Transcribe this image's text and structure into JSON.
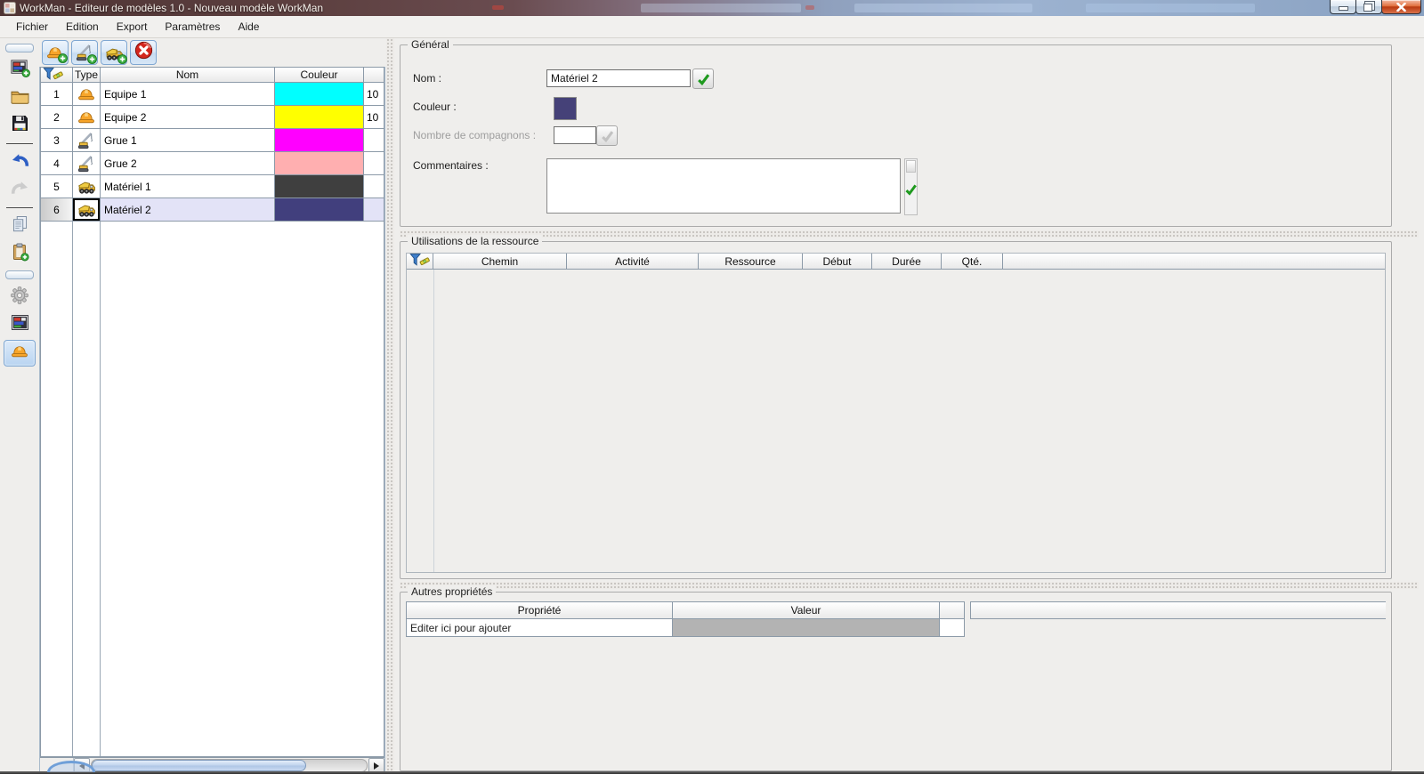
{
  "window": {
    "title": "WorkMan - Editeur de modèles 1.0  - Nouveau modèle WorkMan",
    "controls": [
      {
        "name": "minimize-button"
      },
      {
        "name": "maximize-button"
      },
      {
        "name": "close-button"
      }
    ]
  },
  "menu": {
    "items": [
      "Fichier",
      "Edition",
      "Export",
      "Paramètres",
      "Aide"
    ]
  },
  "side_toolbar": {
    "items": [
      {
        "icon": "grip"
      },
      {
        "icon": "new-model"
      },
      {
        "icon": "open-folder"
      },
      {
        "icon": "save"
      },
      {
        "icon": "separator"
      },
      {
        "icon": "undo"
      },
      {
        "icon": "redo",
        "disabled": true
      },
      {
        "icon": "separator"
      },
      {
        "icon": "copy"
      },
      {
        "icon": "paste"
      },
      {
        "icon": "grip"
      },
      {
        "icon": "gear",
        "disabled": true
      },
      {
        "icon": "model-view"
      },
      {
        "icon": "helmet",
        "selected": true
      }
    ]
  },
  "resource_toolbar": {
    "items": [
      {
        "icon": "add-team"
      },
      {
        "icon": "add-crane"
      },
      {
        "icon": "add-machine"
      },
      {
        "icon": "delete"
      }
    ]
  },
  "resource_table": {
    "headers": {
      "filter": "filter-icon",
      "type": "Type",
      "name": "Nom",
      "color": "Couleur"
    },
    "rows": [
      {
        "num": "1",
        "type": "helmet",
        "name": "Equipe 1",
        "color": "#00FFFF",
        "qty": "10",
        "selected": false
      },
      {
        "num": "2",
        "type": "helmet",
        "name": "Equipe 2",
        "color": "#FFFF00",
        "qty": "10",
        "selected": false
      },
      {
        "num": "3",
        "type": "crane",
        "name": "Grue 1",
        "color": "#FF00FF",
        "qty": "",
        "selected": false
      },
      {
        "num": "4",
        "type": "crane",
        "name": "Grue 2",
        "color": "#FFAFB0",
        "qty": "",
        "selected": false
      },
      {
        "num": "5",
        "type": "truck",
        "name": "Matériel 1",
        "color": "#3F3F3F",
        "qty": "",
        "selected": false
      },
      {
        "num": "6",
        "type": "truck",
        "name": "Matériel 2",
        "color": "#413F7D",
        "qty": "",
        "selected": true
      }
    ],
    "selection_color": "#E3E3F7"
  },
  "general": {
    "title": "Général",
    "name_label": "Nom :",
    "name_value": "Matériel 2",
    "color_label": "Couleur :",
    "color_value": "#454178",
    "companions_label": "Nombre de compagnons :",
    "companions_value": "",
    "comments_label": "Commentaires :",
    "comments_value": ""
  },
  "usages": {
    "title": "Utilisations de la ressource",
    "columns": [
      "Chemin",
      "Activité",
      "Ressource",
      "Début",
      "Durée",
      "Qté."
    ]
  },
  "other_props": {
    "title": "Autres propriétés",
    "columns": [
      "Propriété",
      "Valeur"
    ],
    "add_row_text": "Editer ici pour ajouter"
  }
}
